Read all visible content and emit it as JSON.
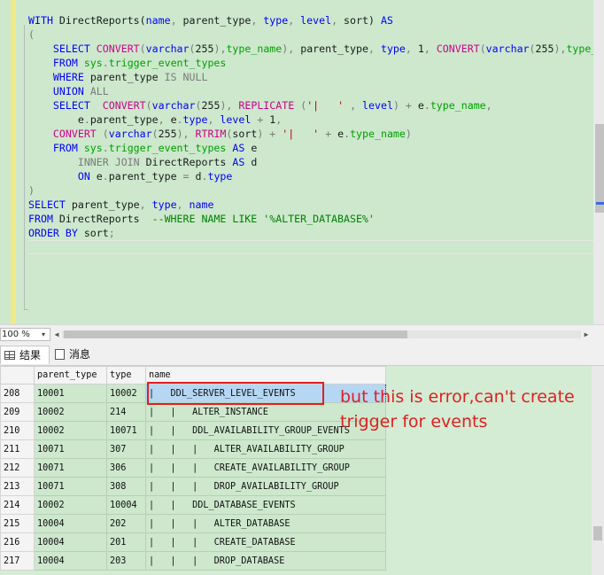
{
  "editor": {
    "code_lines": [
      [
        [
          "kw",
          "WITH "
        ],
        [
          "",
          "DirectReports("
        ],
        [
          "kw",
          "name"
        ],
        [
          "gr",
          ", "
        ],
        [
          "",
          "parent_type"
        ],
        [
          "gr",
          ", "
        ],
        [
          "kw",
          "type"
        ],
        [
          "gr",
          ", "
        ],
        [
          "kw",
          "level"
        ],
        [
          "gr",
          ", "
        ],
        [
          "",
          "sort) "
        ],
        [
          "kw",
          "AS"
        ]
      ],
      [
        [
          "gr",
          "("
        ]
      ],
      [
        [
          "",
          "    "
        ],
        [
          "kw",
          "SELECT "
        ],
        [
          "fn",
          "CONVERT"
        ],
        [
          "gr",
          "("
        ],
        [
          "kw",
          "varchar"
        ],
        [
          "gr",
          "("
        ],
        [
          "",
          "255"
        ],
        [
          "gr",
          "),"
        ],
        [
          "sy",
          "type_name"
        ],
        [
          "gr",
          "), "
        ],
        [
          "",
          "parent_type"
        ],
        [
          "gr",
          ", "
        ],
        [
          "kw",
          "type"
        ],
        [
          "gr",
          ", "
        ],
        [
          "",
          "1"
        ],
        [
          "gr",
          ", "
        ],
        [
          "fn",
          "CONVERT"
        ],
        [
          "gr",
          "("
        ],
        [
          "kw",
          "varchar"
        ],
        [
          "gr",
          "("
        ],
        [
          "",
          "255"
        ],
        [
          "gr",
          "),"
        ],
        [
          "sy",
          "type_name"
        ],
        [
          "gr",
          "),"
        ]
      ],
      [
        [
          "",
          "    "
        ],
        [
          "kw",
          "FROM "
        ],
        [
          "sy",
          "sys"
        ],
        [
          "gr",
          "."
        ],
        [
          "sy",
          "trigger_event_types"
        ]
      ],
      [
        [
          "",
          "    "
        ],
        [
          "kw",
          "WHERE "
        ],
        [
          "",
          "parent_type "
        ],
        [
          "gr",
          "IS NULL"
        ]
      ],
      [
        [
          "",
          "    "
        ],
        [
          "kw",
          "UNION "
        ],
        [
          "gr",
          "ALL"
        ]
      ],
      [
        [
          "",
          "    "
        ],
        [
          "kw",
          "SELECT  "
        ],
        [
          "fn",
          "CONVERT"
        ],
        [
          "gr",
          "("
        ],
        [
          "kw",
          "varchar"
        ],
        [
          "gr",
          "("
        ],
        [
          "",
          "255"
        ],
        [
          "gr",
          "), "
        ],
        [
          "fn",
          "REPLICATE "
        ],
        [
          "gr",
          "("
        ],
        [
          "st",
          "'|   ' "
        ],
        [
          "gr",
          ", "
        ],
        [
          "kw",
          "level"
        ],
        [
          "gr",
          ") + "
        ],
        [
          "",
          "e"
        ],
        [
          "gr",
          "."
        ],
        [
          "sy",
          "type_name"
        ],
        [
          "gr",
          ","
        ]
      ],
      [
        [
          "",
          "        e"
        ],
        [
          "gr",
          "."
        ],
        [
          "",
          "parent_type"
        ],
        [
          "gr",
          ", "
        ],
        [
          "",
          "e"
        ],
        [
          "gr",
          "."
        ],
        [
          "kw",
          "type"
        ],
        [
          "gr",
          ", "
        ],
        [
          "kw",
          "level "
        ],
        [
          "gr",
          "+ "
        ],
        [
          "",
          "1"
        ],
        [
          "gr",
          ","
        ]
      ],
      [
        [
          "",
          "    "
        ],
        [
          "fn",
          "CONVERT "
        ],
        [
          "gr",
          "("
        ],
        [
          "kw",
          "varchar"
        ],
        [
          "gr",
          "("
        ],
        [
          "",
          "255"
        ],
        [
          "gr",
          "), "
        ],
        [
          "fn",
          "RTRIM"
        ],
        [
          "gr",
          "("
        ],
        [
          "",
          "sort"
        ],
        [
          "gr",
          ") + "
        ],
        [
          "st",
          "'|   ' "
        ],
        [
          "gr",
          "+ "
        ],
        [
          "",
          "e"
        ],
        [
          "gr",
          "."
        ],
        [
          "sy",
          "type_name"
        ],
        [
          "gr",
          ")"
        ]
      ],
      [
        [
          "",
          "    "
        ],
        [
          "kw",
          "FROM "
        ],
        [
          "sy",
          "sys"
        ],
        [
          "gr",
          "."
        ],
        [
          "sy",
          "trigger_event_types "
        ],
        [
          "kw",
          "AS "
        ],
        [
          "",
          "e"
        ]
      ],
      [
        [
          "",
          "        "
        ],
        [
          "gr",
          "INNER JOIN "
        ],
        [
          "",
          "DirectReports "
        ],
        [
          "kw",
          "AS "
        ],
        [
          "",
          "d"
        ]
      ],
      [
        [
          "",
          "        "
        ],
        [
          "kw",
          "ON "
        ],
        [
          "",
          "e"
        ],
        [
          "gr",
          "."
        ],
        [
          "",
          "parent_type "
        ],
        [
          "gr",
          "= "
        ],
        [
          "",
          "d"
        ],
        [
          "gr",
          "."
        ],
        [
          "kw",
          "type"
        ]
      ],
      [
        [
          "gr",
          ")"
        ]
      ],
      [
        [
          "kw",
          "SELECT "
        ],
        [
          "",
          "parent_type"
        ],
        [
          "gr",
          ", "
        ],
        [
          "kw",
          "type"
        ],
        [
          "gr",
          ", "
        ],
        [
          "kw",
          "name"
        ]
      ],
      [
        [
          "kw",
          "FROM "
        ],
        [
          "",
          "DirectReports  "
        ],
        [
          "cm",
          "--WHERE NAME LIKE '%ALTER_DATABASE%'"
        ]
      ],
      [
        [
          "kw",
          "ORDER BY "
        ],
        [
          "",
          "sort"
        ],
        [
          "gr",
          ";"
        ]
      ],
      [
        [
          "",
          ""
        ]
      ]
    ]
  },
  "statusbar": {
    "zoom": "100 %",
    "zoom_arrow": "▾",
    "left_arrow": "◀",
    "right_arrow": "▶"
  },
  "tabs": {
    "results": "结果",
    "messages": "消息"
  },
  "grid": {
    "headers": [
      "",
      "parent_type",
      "type",
      "name"
    ],
    "rows": [
      {
        "rn": "208",
        "parent_type": "10001",
        "type": "10002",
        "name": "|   DDL_SERVER_LEVEL_EVENTS"
      },
      {
        "rn": "209",
        "parent_type": "10002",
        "type": "214",
        "name": "|   |   ALTER_INSTANCE"
      },
      {
        "rn": "210",
        "parent_type": "10002",
        "type": "10071",
        "name": "|   |   DDL_AVAILABILITY_GROUP_EVENTS"
      },
      {
        "rn": "211",
        "parent_type": "10071",
        "type": "307",
        "name": "|   |   |   ALTER_AVAILABILITY_GROUP"
      },
      {
        "rn": "212",
        "parent_type": "10071",
        "type": "306",
        "name": "|   |   |   CREATE_AVAILABILITY_GROUP"
      },
      {
        "rn": "213",
        "parent_type": "10071",
        "type": "308",
        "name": "|   |   |   DROP_AVAILABILITY_GROUP"
      },
      {
        "rn": "214",
        "parent_type": "10002",
        "type": "10004",
        "name": "|   |   DDL_DATABASE_EVENTS"
      },
      {
        "rn": "215",
        "parent_type": "10004",
        "type": "202",
        "name": "|   |   |   ALTER_DATABASE"
      },
      {
        "rn": "216",
        "parent_type": "10004",
        "type": "201",
        "name": "|   |   |   CREATE_DATABASE"
      },
      {
        "rn": "217",
        "parent_type": "10004",
        "type": "203",
        "name": "|   |   |   DROP_DATABASE"
      }
    ],
    "selected_row": 0
  },
  "annotation": {
    "text": "but this is error,can't create trigger for events",
    "color": "#e02020"
  }
}
